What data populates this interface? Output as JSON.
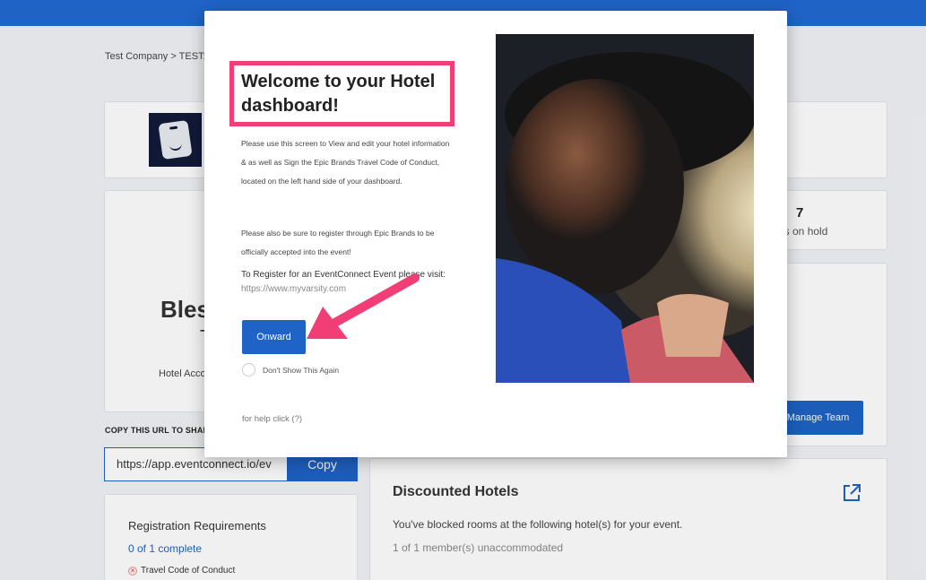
{
  "breadcrumb": "Test Company > TEST:",
  "hotel": {
    "name_line1": "Bles",
    "name_line2": "T",
    "accounts_label": "Hotel Acco"
  },
  "share": {
    "label": "COPY THIS URL TO SHAR",
    "url": "https://app.eventconnect.io/ev",
    "copy_label": "Copy"
  },
  "requirements": {
    "title": "Registration Requirements",
    "progress": "0 of 1 complete",
    "items": [
      "Travel Code of Conduct"
    ]
  },
  "stats": {
    "number": "7",
    "label": "ns on hold"
  },
  "team": {
    "manage_label": "Manage Team"
  },
  "discounted": {
    "title": "Discounted Hotels",
    "description": "You've blocked rooms at the following hotel(s) for your event.",
    "subtext": "1 of 1 member(s) unaccommodated"
  },
  "modal": {
    "title": "Welcome to your Hotel dashboard!",
    "paragraph1": "Please use this screen to View and edit your hotel information & as well as Sign the Epic Brands Travel Code of Conduct, located on the left hand side of your dashboard.",
    "paragraph2": "Please also be sure to register through Epic Brands to be officially accepted into the event!",
    "register_text": "To Register for an EventConnect Event please visit:",
    "register_url": "https://www.myvarsity.com",
    "onward_label": "Onward",
    "dont_show_label": "Don't Show This Again",
    "help_label": "for help click (?)"
  },
  "colors": {
    "brand_blue": "#1f63c6",
    "highlight_pink": "#f13e77"
  }
}
